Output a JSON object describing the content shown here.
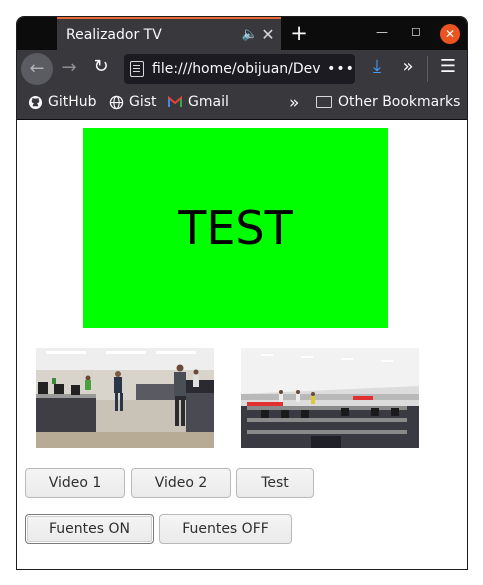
{
  "browser": {
    "tab_title": "Realizador TV",
    "url": "file:///home/obijuan/Dev",
    "url_more": "•••",
    "icons": {
      "audio": "speaker-icon",
      "tab_close": "close-icon",
      "new_tab": "plus-icon",
      "back": "arrow-left-icon",
      "forward": "arrow-right-icon",
      "reload": "reload-icon",
      "download": "download-icon",
      "overflow": "chevrons-right-icon",
      "menu": "hamburger-icon"
    },
    "accent": "#e66a36",
    "close_color": "#e95420"
  },
  "bookmarks": {
    "items": [
      {
        "label": "GitHub",
        "icon": "github-icon"
      },
      {
        "label": "Gist",
        "icon": "globe-icon"
      },
      {
        "label": "Gmail",
        "icon": "gmail-icon"
      }
    ],
    "other_label": "Other Bookmarks"
  },
  "page": {
    "monitor": {
      "text": "TEST",
      "color": "#00ff00"
    },
    "buttons": {
      "video1": "Video 1",
      "video2": "Video 2",
      "test": "Test",
      "fuentes_on": "Fuentes ON",
      "fuentes_off": "Fuentes OFF"
    }
  }
}
